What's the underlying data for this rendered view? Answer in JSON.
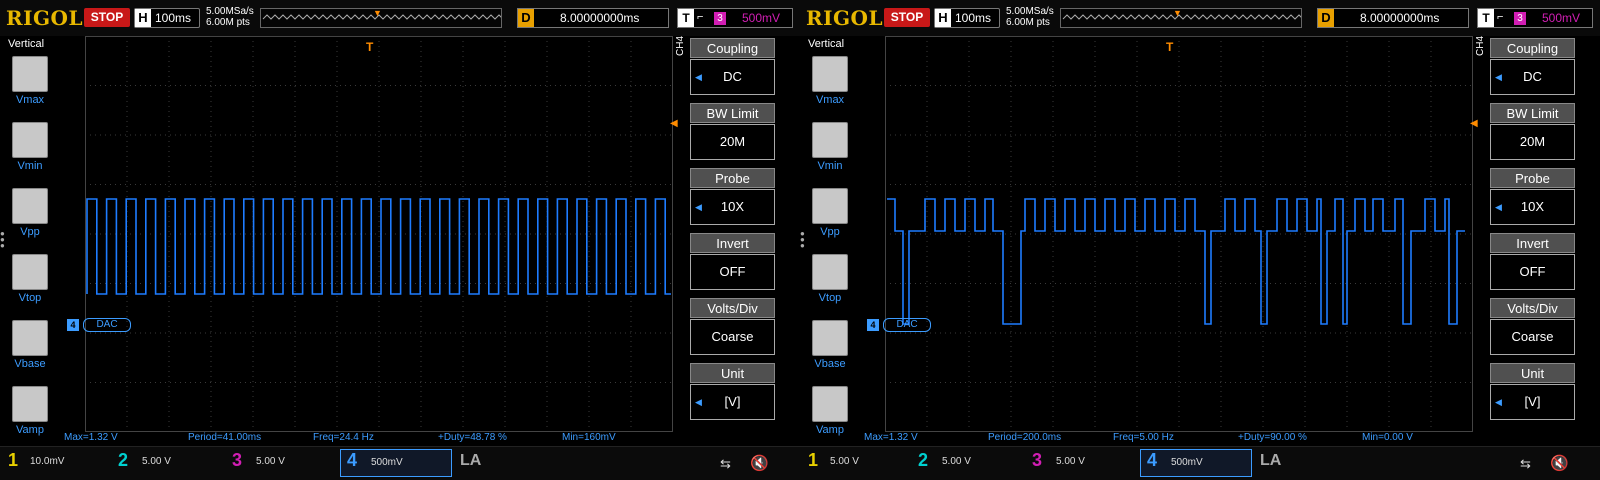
{
  "brand": "RIGOL",
  "scopes": [
    {
      "status": "STOP",
      "timebase_label": "H",
      "timebase": "100ms",
      "sample_rate": "5.00MSa/s",
      "memory_depth": "6.00M pts",
      "delay_label": "D",
      "delay": "8.00000000ms",
      "trigger_label": "T",
      "trigger_source": "3",
      "trigger_level": "500mV",
      "vertical_title": "Vertical",
      "measure_items": [
        "Vmax",
        "Vmin",
        "Vpp",
        "Vtop",
        "Vbase",
        "Vamp"
      ],
      "channel_tag": "CH4",
      "channel_label": "DAC",
      "channel_number": "4",
      "menu": [
        {
          "head": "Coupling",
          "value": "DC"
        },
        {
          "head": "BW Limit",
          "value": "20M"
        },
        {
          "head": "Probe",
          "value": "10X"
        },
        {
          "head": "Invert",
          "value": "OFF"
        },
        {
          "head": "Volts/Div",
          "value": "Coarse"
        },
        {
          "head": "Unit",
          "value": "[V]"
        }
      ],
      "measurements": {
        "max": "Max=1.32 V",
        "period": "Period=41.00ms",
        "freq": "Freq=24.4 Hz",
        "duty": "+Duty=48.78 %",
        "min": "Min=160mV"
      },
      "channels": [
        {
          "n": "1",
          "v": "10.0mV",
          "color": "#e8d000"
        },
        {
          "n": "2",
          "v": "5.00 V",
          "color": "#00d0d0"
        },
        {
          "n": "3",
          "v": "5.00 V",
          "color": "#d21eb4"
        },
        {
          "n": "4",
          "v": "500mV",
          "color": "#3c9cff"
        }
      ],
      "la_label": "LA",
      "waveform": "square"
    },
    {
      "status": "STOP",
      "timebase_label": "H",
      "timebase": "100ms",
      "sample_rate": "5.00MSa/s",
      "memory_depth": "6.00M pts",
      "delay_label": "D",
      "delay": "8.00000000ms",
      "trigger_label": "T",
      "trigger_source": "3",
      "trigger_level": "500mV",
      "vertical_title": "Vertical",
      "measure_items": [
        "Vmax",
        "Vmin",
        "Vpp",
        "Vtop",
        "Vbase",
        "Vamp"
      ],
      "channel_tag": "CH4",
      "channel_label": "DAC",
      "channel_number": "4",
      "menu": [
        {
          "head": "Coupling",
          "value": "DC"
        },
        {
          "head": "BW Limit",
          "value": "20M"
        },
        {
          "head": "Probe",
          "value": "10X"
        },
        {
          "head": "Invert",
          "value": "OFF"
        },
        {
          "head": "Volts/Div",
          "value": "Coarse"
        },
        {
          "head": "Unit",
          "value": "[V]"
        }
      ],
      "measurements": {
        "max": "Max=1.32 V",
        "period": "Period=200.0ms",
        "freq": "Freq=5.00 Hz",
        "duty": "+Duty=90.00 %",
        "min": "Min=0.00 V"
      },
      "channels": [
        {
          "n": "1",
          "v": "5.00 V",
          "color": "#e8d000"
        },
        {
          "n": "2",
          "v": "5.00 V",
          "color": "#00d0d0"
        },
        {
          "n": "3",
          "v": "5.00 V",
          "color": "#d21eb4"
        },
        {
          "n": "4",
          "v": "500mV",
          "color": "#3c9cff"
        }
      ],
      "la_label": "LA",
      "waveform": "steps"
    }
  ],
  "colors": {
    "trace": "#1e7cff",
    "grid": "#3a3a3a",
    "accent": "#ff8c00"
  }
}
